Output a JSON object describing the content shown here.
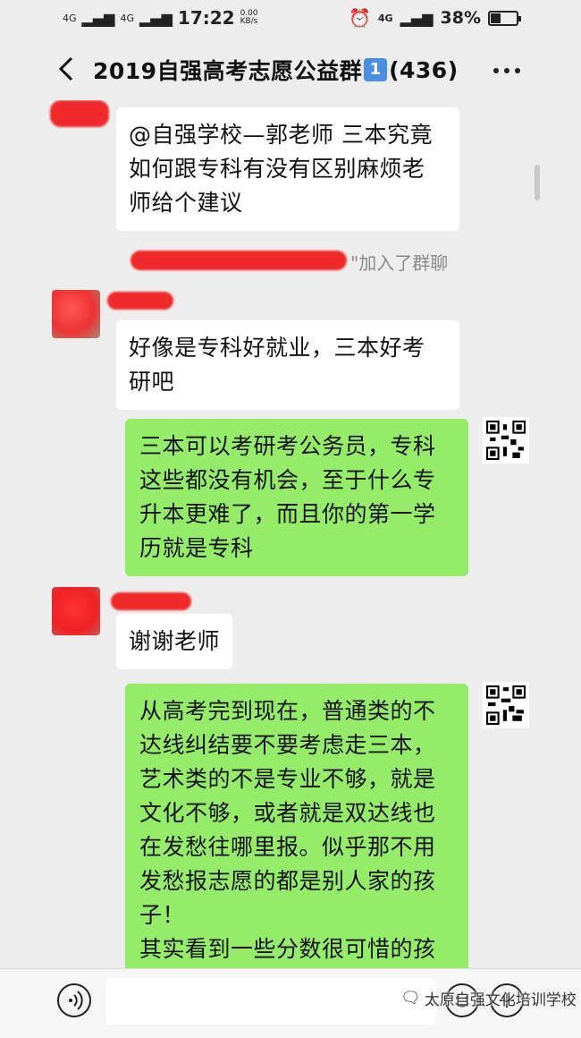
{
  "status": {
    "sig1": "4G",
    "sig2": "4G",
    "time": "17:22",
    "speed": "0.00 KB/s",
    "net": "4G",
    "battery": "38%",
    "battery_level": 0.38
  },
  "header": {
    "title": "2019自强高考志愿公益群",
    "badge": "1",
    "count": "(436)"
  },
  "messages": [
    {
      "dir": "in",
      "text": "@自强学校—郭老师  三本究竟如何跟专科有没有区别麻烦老师给个建议"
    },
    {
      "dir": "system",
      "text": "\"加入了群聊"
    },
    {
      "dir": "in",
      "text": "好像是专科好就业，三本好考研吧"
    },
    {
      "dir": "out",
      "text": "三本可以考研考公务员，专科这些都没有机会，至于什么专升本更难了，而且你的第一学历就是专科"
    },
    {
      "dir": "in",
      "text": "谢谢老师"
    },
    {
      "dir": "out",
      "text": "从高考完到现在，普通类的不达线纠结要不要考虑走三本，艺术类的不是专业不够，就是文化不够，或者就是双达线也在发愁往哪里报。似乎那不用发愁报志愿的都是别人家的孩子！\n其实看到一些分数很可惜的孩子们，补习一年完全有希望。但是听到的很多就是:啥孩子不想补"
    }
  ],
  "watermark": "太原自强文化培训学校",
  "colors": {
    "out_bubble": "#95ec69",
    "in_bubble": "#ffffff",
    "background": "#ededed",
    "redaction": "#f02a2a"
  },
  "icons": {
    "back": "back-arrow-icon",
    "more": "more-icon",
    "voice": "voice-icon",
    "emoji": "emoji-icon",
    "plus": "plus-icon"
  }
}
